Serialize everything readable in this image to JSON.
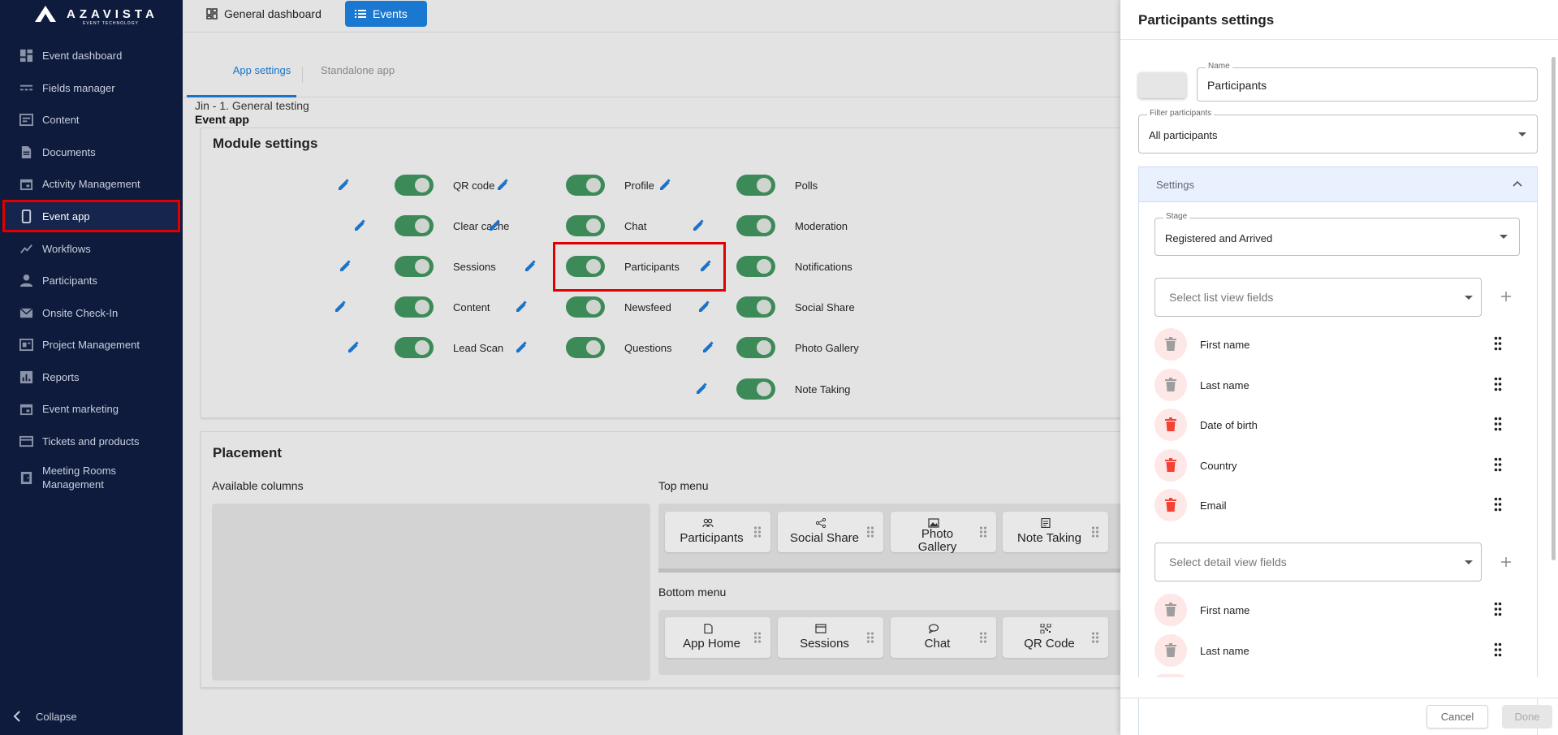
{
  "brand": {
    "name": "AZAVISTA",
    "tagline": "EVENT TECHNOLOGY"
  },
  "sidebar": {
    "items": [
      {
        "label": "Event dashboard",
        "icon": "dashboard-icon"
      },
      {
        "label": "Fields manager",
        "icon": "fields-icon"
      },
      {
        "label": "Content",
        "icon": "content-icon"
      },
      {
        "label": "Documents",
        "icon": "document-icon"
      },
      {
        "label": "Activity Management",
        "icon": "calendar-icon"
      },
      {
        "label": "Event app",
        "icon": "phone-icon"
      },
      {
        "label": "Workflows",
        "icon": "workflow-icon"
      },
      {
        "label": "Participants",
        "icon": "person-icon"
      },
      {
        "label": "Onsite Check-In",
        "icon": "mail-icon"
      },
      {
        "label": "Project Management",
        "icon": "project-icon"
      },
      {
        "label": "Reports",
        "icon": "report-icon"
      },
      {
        "label": "Event marketing",
        "icon": "calendar-icon"
      },
      {
        "label": "Tickets and products",
        "icon": "card-icon"
      },
      {
        "label": "Meeting Rooms Management",
        "icon": "room-icon"
      }
    ],
    "collapse_label": "Collapse"
  },
  "topbar": {
    "general_dashboard": "General dashboard",
    "events": "Events"
  },
  "tabs": {
    "app_settings": "App settings",
    "standalone_app": "Standalone app"
  },
  "breadcrumb": {
    "line1": "Jin - 1. General testing",
    "line2": "Event app"
  },
  "module_settings": {
    "title": "Module settings",
    "col1": [
      "QR code",
      "Clear cache",
      "Sessions",
      "Content",
      "Lead Scan"
    ],
    "col2": [
      "Profile",
      "Chat",
      "Participants",
      "Newsfeed",
      "Questions"
    ],
    "col3": [
      "Polls",
      "Moderation",
      "Notifications",
      "Social Share",
      "Photo Gallery",
      "Note Taking"
    ]
  },
  "placement": {
    "title": "Placement",
    "available_columns": "Available columns",
    "top_menu": "Top menu",
    "bottom_menu": "Bottom menu",
    "top_items": [
      {
        "label": "Participants",
        "icon": "people-icon"
      },
      {
        "label": "Social Share",
        "icon": "share-icon"
      },
      {
        "label": "Photo Gallery",
        "icon": "photo-icon"
      },
      {
        "label": "Note Taking",
        "icon": "note-icon"
      }
    ],
    "bottom_items": [
      {
        "label": "App Home",
        "icon": "file-icon"
      },
      {
        "label": "Sessions",
        "icon": "calendar-icon"
      },
      {
        "label": "Chat",
        "icon": "chat-icon"
      },
      {
        "label": "QR Code",
        "icon": "qr-icon"
      }
    ]
  },
  "drawer": {
    "title": "Participants settings",
    "name_label": "Name",
    "name_value": "Participants",
    "filter_label": "Filter participants",
    "filter_value": "All participants",
    "settings_label": "Settings",
    "stage_label": "Stage",
    "stage_value": "Registered and Arrived",
    "list_view_placeholder": "Select list view fields",
    "list_fields": [
      "First name",
      "Last name",
      "Date of birth",
      "Country",
      "Email"
    ],
    "detail_view_placeholder": "Select detail view fields",
    "detail_fields": [
      "First name",
      "Last name"
    ],
    "cancel": "Cancel",
    "done": "Done"
  },
  "colors": {
    "sidebar": "#0e1b3d",
    "accent": "#1a73c8",
    "toggle_on": "#3d8a59",
    "highlight": "#e00000",
    "trash_active": "#f44336"
  }
}
